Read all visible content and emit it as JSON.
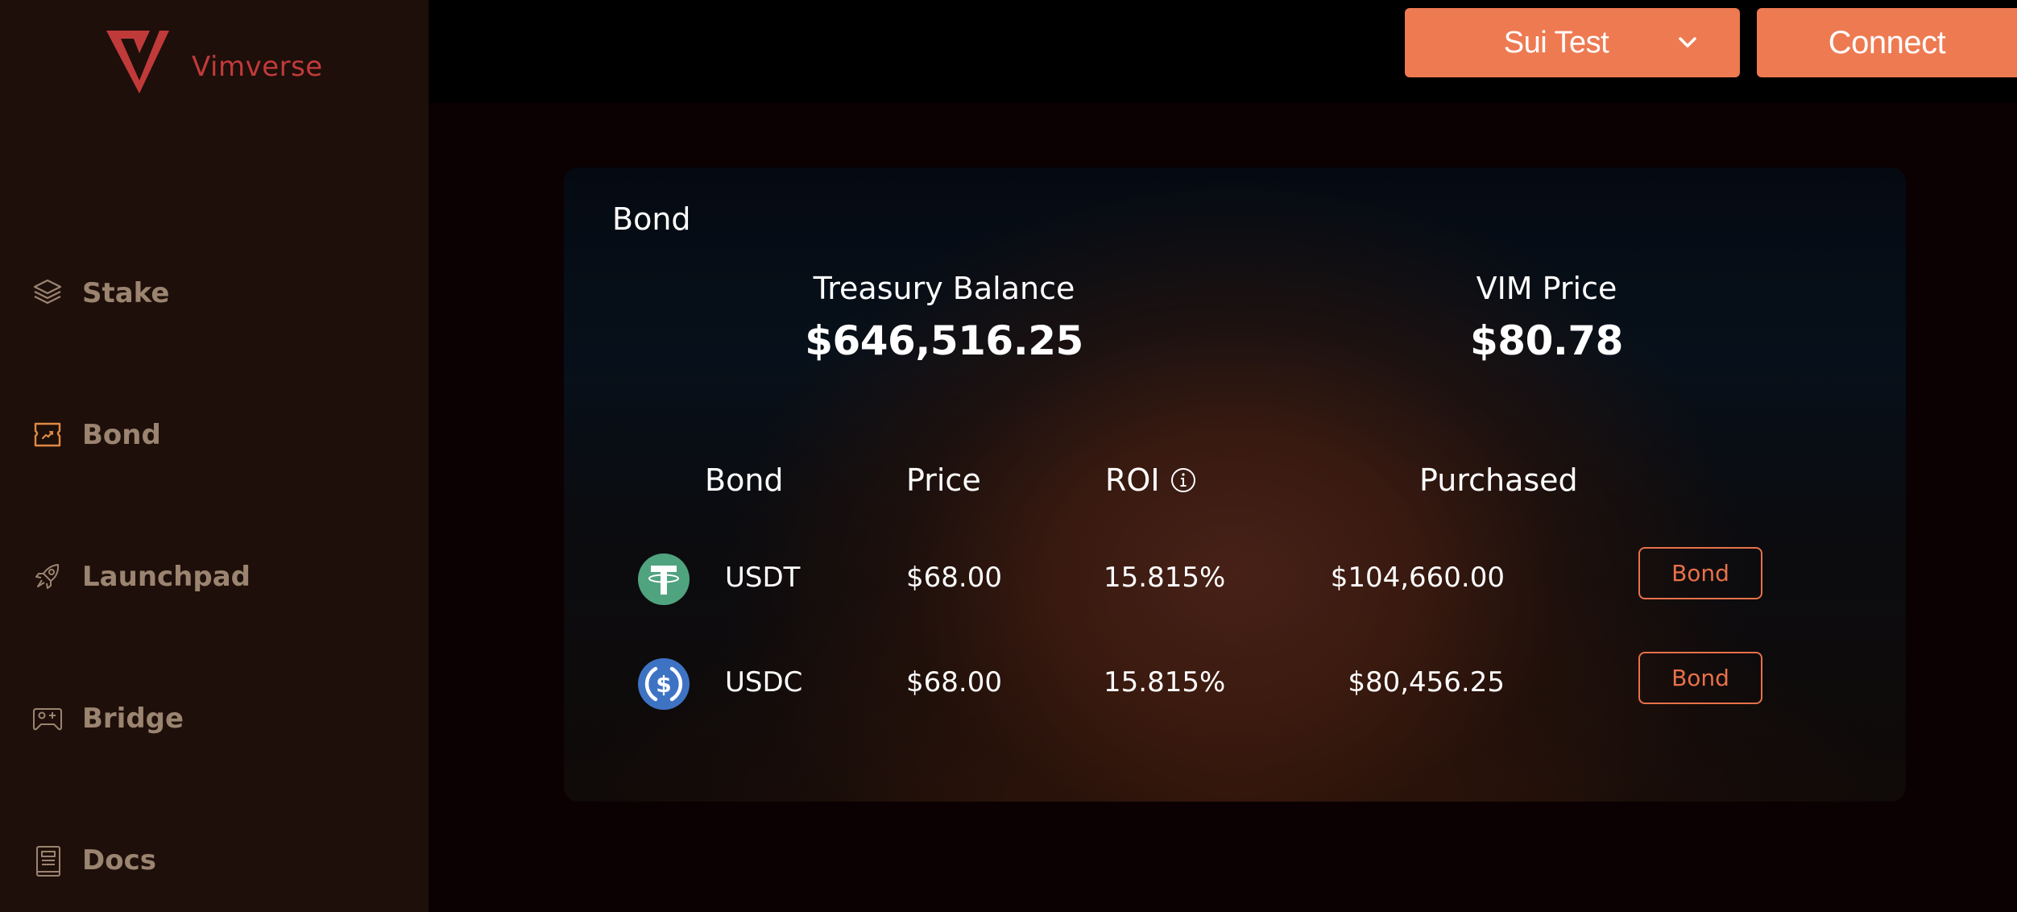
{
  "brand": {
    "name": "Vimverse",
    "logo_icon": "vimverse-v-logo",
    "logo_color": "#c13a3a"
  },
  "sidebar": {
    "items": [
      {
        "label": "Stake",
        "icon": "layers-icon",
        "active": false
      },
      {
        "label": "Bond",
        "icon": "bond-ticket-icon",
        "active": true
      },
      {
        "label": "Launchpad",
        "icon": "rocket-icon",
        "active": false
      },
      {
        "label": "Bridge",
        "icon": "gamepad-icon",
        "active": false
      },
      {
        "label": "Docs",
        "icon": "book-icon",
        "active": false
      }
    ],
    "text_color": "#9b8470",
    "active_icon_color": "#e08a44"
  },
  "header": {
    "network_selector": {
      "label": "Sui Test",
      "icon": "chevron-down-icon"
    },
    "connect_label": "Connect",
    "accent_color": "#ee7a52"
  },
  "card": {
    "title": "Bond",
    "stats": {
      "treasury": {
        "label": "Treasury Balance",
        "value": "$646,516.25"
      },
      "vim_price": {
        "label": "VIM Price",
        "value": "$80.78"
      }
    },
    "table": {
      "headers": {
        "bond": "Bond",
        "price": "Price",
        "roi": "ROI",
        "roi_icon": "info-icon",
        "purchased": "Purchased"
      },
      "rows": [
        {
          "token": "USDT",
          "icon": "usdt-icon",
          "icon_color": "#50a37f",
          "price": "$68.00",
          "roi": "15.815%",
          "purchased": "$104,660.00",
          "action": "Bond"
        },
        {
          "token": "USDC",
          "icon": "usdc-icon",
          "icon_color": "#3e73c4",
          "price": "$68.00",
          "roi": "15.815%",
          "purchased": "$80,456.25",
          "action": "Bond"
        }
      ]
    }
  }
}
